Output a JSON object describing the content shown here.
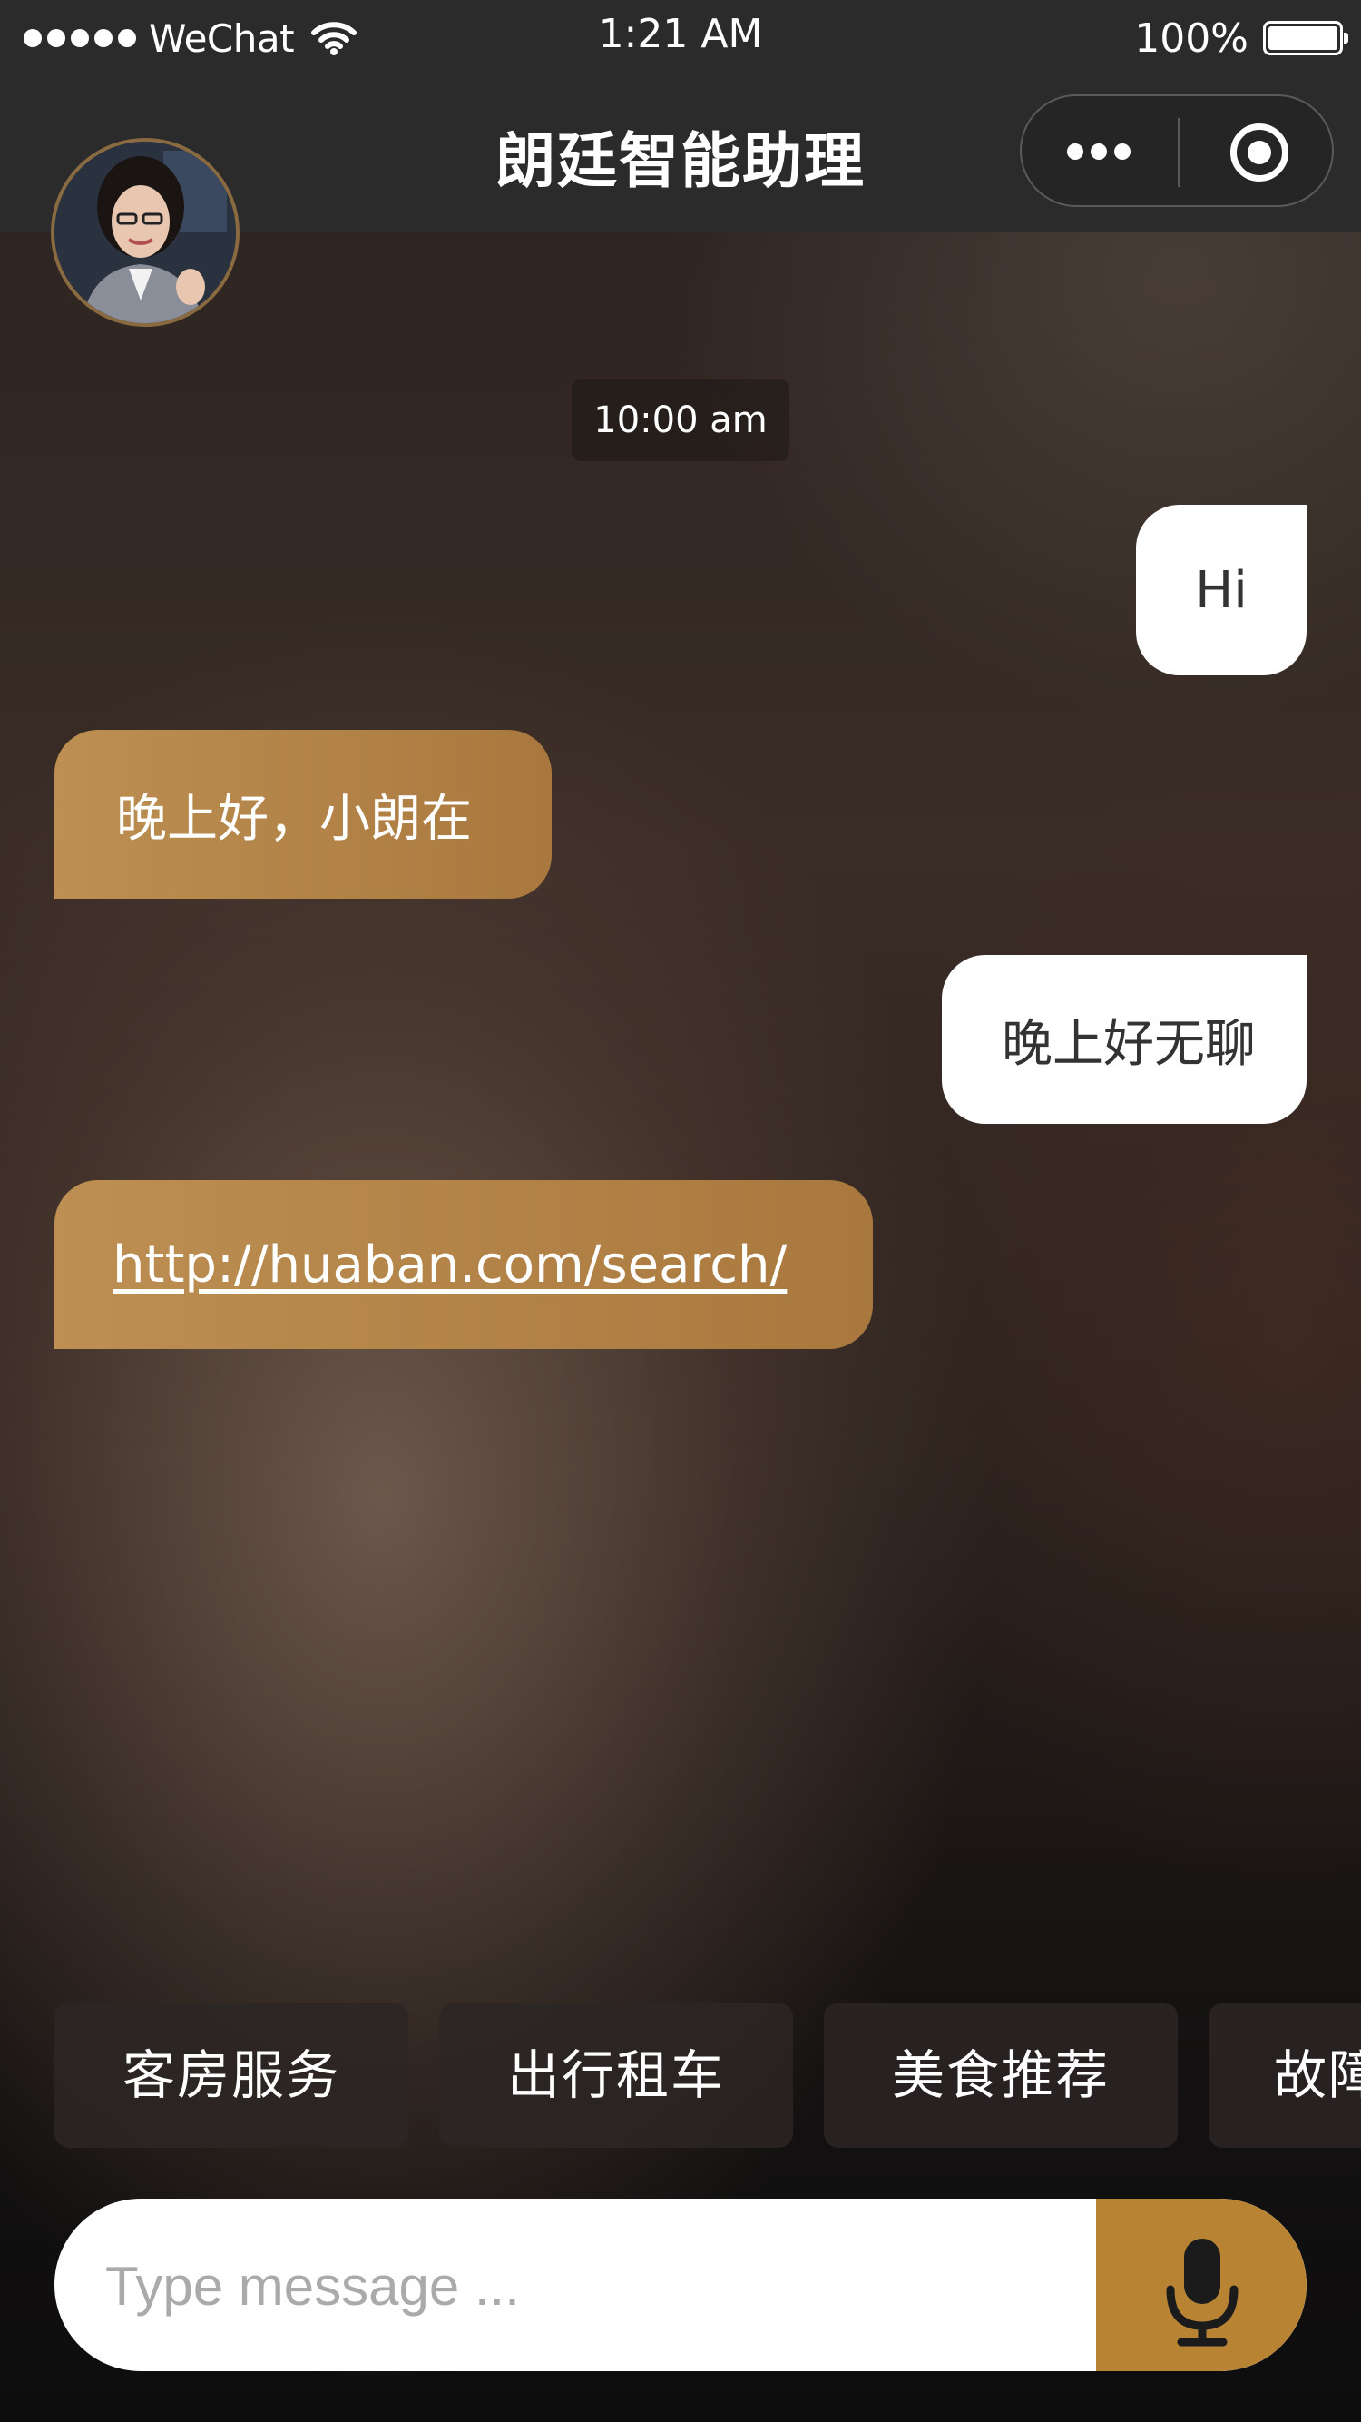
{
  "status_bar": {
    "carrier": "WeChat",
    "time": "1:21 AM",
    "battery": "100%"
  },
  "nav": {
    "title": "朗廷智能助理",
    "more_icon": "more-dots-icon",
    "close_icon": "target-icon"
  },
  "chat": {
    "timestamp": "10:00 am",
    "messages": [
      {
        "from": "user",
        "text": "Hi"
      },
      {
        "from": "bot",
        "text": "晚上好，小朗在"
      },
      {
        "from": "user",
        "text": "晚上好无聊"
      },
      {
        "from": "bot",
        "text": "http://huaban.com/search/"
      }
    ]
  },
  "quick_replies": [
    "客房服务",
    "出行租车",
    "美食推荐",
    "故障"
  ],
  "composer": {
    "placeholder": "Type message ...",
    "mic_icon": "microphone-icon"
  },
  "colors": {
    "accent": "#b88434",
    "bot_bubble": "#b6884c",
    "nav_bg": "#2b2b2b"
  }
}
